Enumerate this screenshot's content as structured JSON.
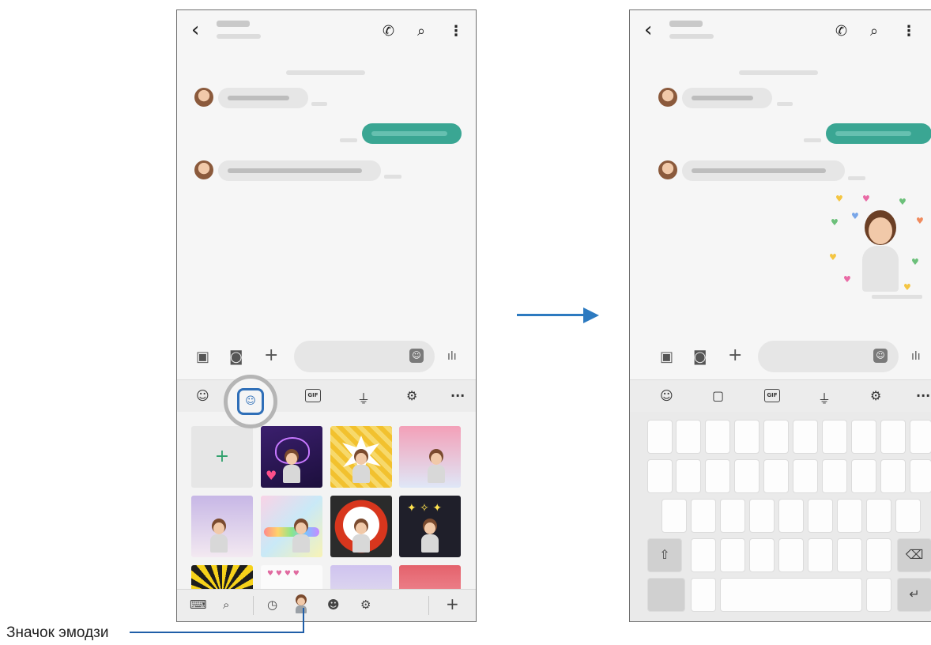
{
  "left_phone": {
    "icons": {
      "back": "chevron-left-icon",
      "call": "phone-icon",
      "search": "search-icon",
      "more": "more-vertical-icon",
      "gallery": "image-icon",
      "camera": "camera-icon",
      "add": "plus-icon",
      "sticker": "sticker-icon",
      "voice": "voice-wave-icon"
    },
    "add_tile_label": "+",
    "toolbar_gif": "GIF",
    "toolbar_more": "···",
    "bottom_add": "+"
  },
  "right_phone": {
    "toolbar_gif": "GIF"
  },
  "callout": {
    "label": "Значок эмодзи"
  },
  "colors": {
    "sent_bubble": "#3aa693",
    "highlight_icon": "#2f6fb8",
    "arrow": "#2d7ac0"
  }
}
